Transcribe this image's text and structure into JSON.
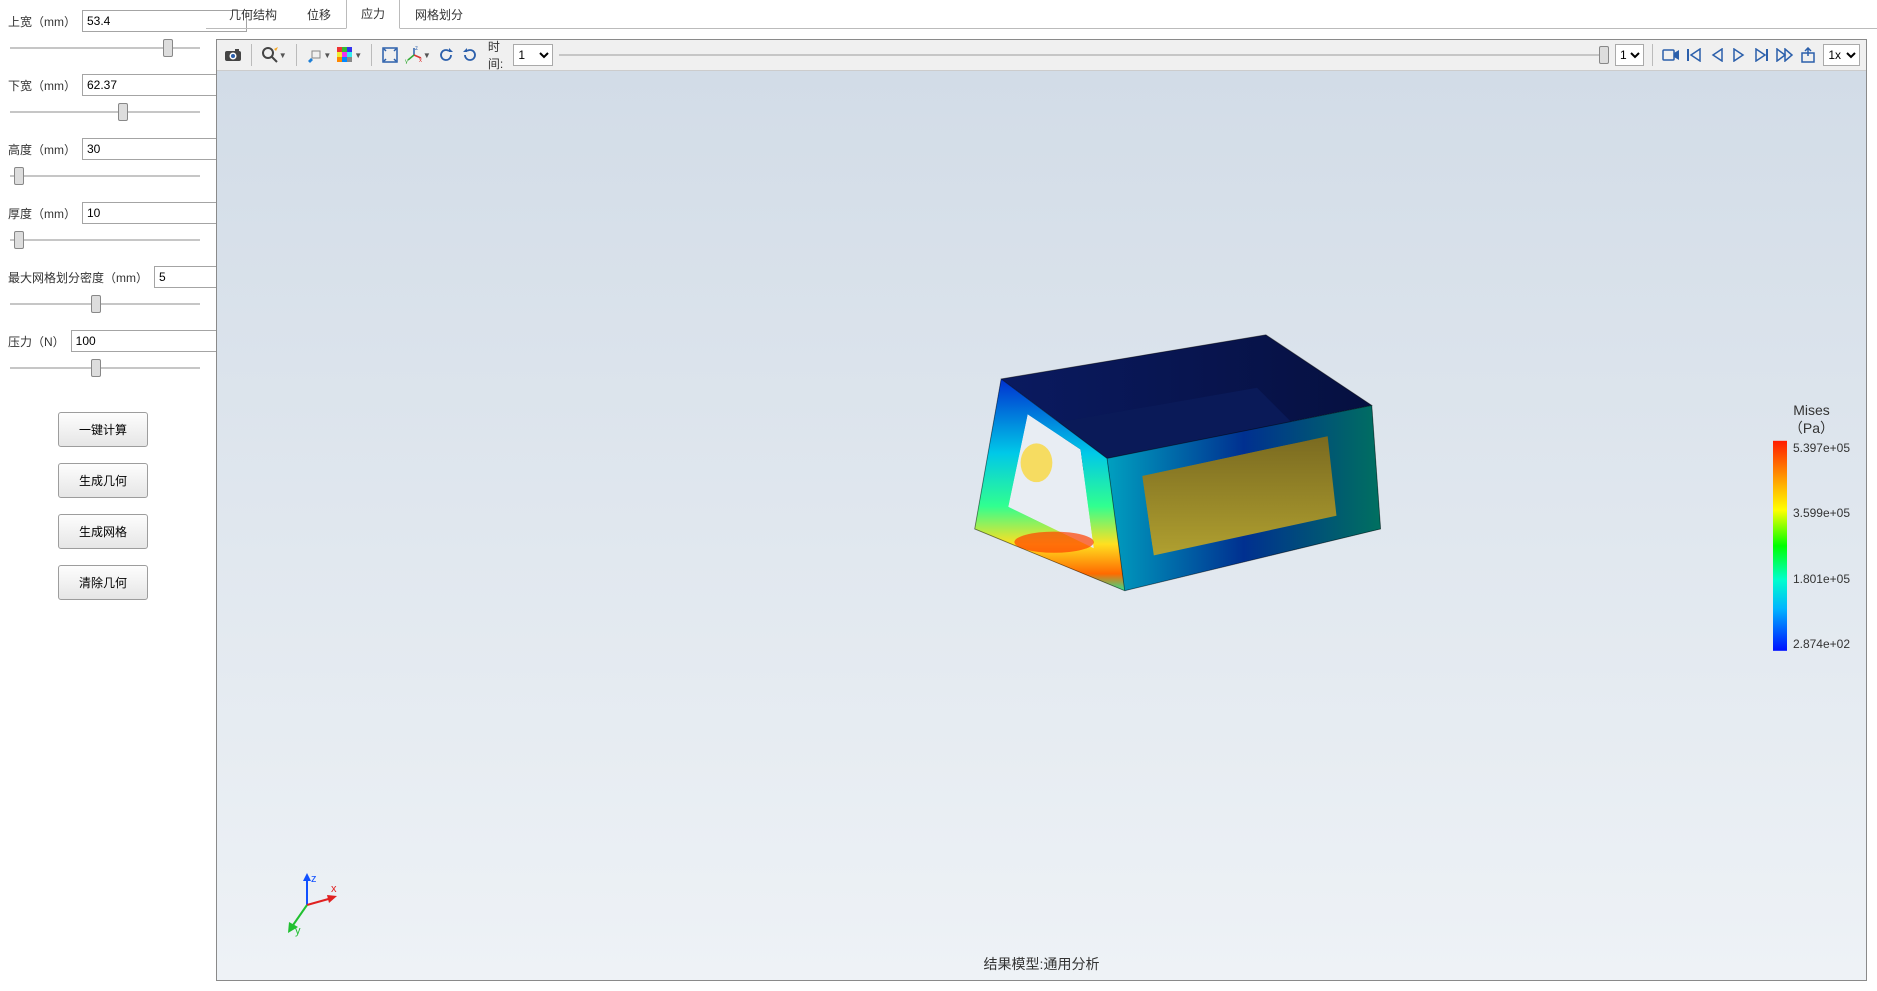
{
  "sidebar": {
    "params": [
      {
        "label": "上宽（mm）",
        "value": "53.4",
        "slider": 85
      },
      {
        "label": "下宽（mm）",
        "value": "62.37",
        "slider": 60
      },
      {
        "label": "高度（mm）",
        "value": "30",
        "slider": 2
      },
      {
        "label": "厚度（mm）",
        "value": "10",
        "slider": 2
      },
      {
        "label": "最大网格划分密度（mm）",
        "value": "5",
        "slider": 45
      },
      {
        "label": "压力（N）",
        "value": "100",
        "slider": 45
      }
    ],
    "buttons": [
      "一键计算",
      "生成几何",
      "生成网格",
      "清除几何"
    ]
  },
  "tabs": {
    "items": [
      "几何结构",
      "位移",
      "应力",
      "网格划分"
    ],
    "activeIndex": 2
  },
  "toolbar": {
    "time_label": "时间:",
    "time_value": "1",
    "frame_value": "1",
    "speed_value": "1x"
  },
  "viewer": {
    "footer": "结果模型:通用分析",
    "legend": {
      "title1": "Mises",
      "title2": "（Pa）",
      "ticks": [
        "5.397e+05",
        "3.599e+05",
        "1.801e+05",
        "2.874e+02"
      ]
    }
  },
  "icons": {
    "camera": "camera-icon",
    "zoom": "zoom-rubberband-icon",
    "brush": "brush-icon",
    "cube": "color-cube-icon",
    "fit": "fit-view-icon",
    "axes": "axes-mode-icon",
    "rotccw": "rotate-ccw-icon",
    "rotcw": "rotate-cw-icon",
    "rec": "record-icon",
    "first": "first-frame-icon",
    "prev": "prev-frame-icon",
    "play": "play-icon",
    "next": "next-frame-icon",
    "last": "last-frame-icon",
    "export": "export-icon"
  }
}
